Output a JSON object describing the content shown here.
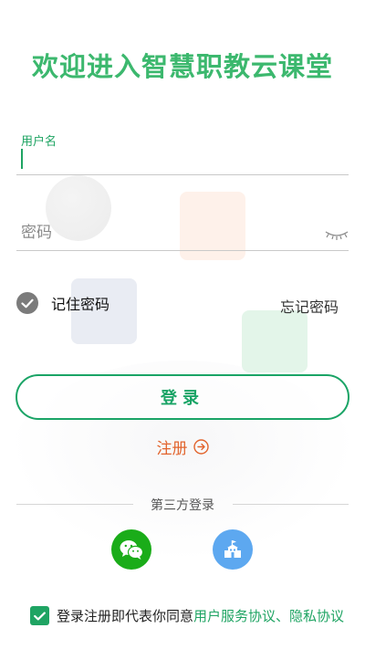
{
  "app_title": "欢迎进入智慧职教云课堂",
  "username": {
    "label": "用户名",
    "value": ""
  },
  "password": {
    "placeholder": "密码",
    "value": ""
  },
  "remember": {
    "label": "记住密码",
    "checked": true
  },
  "forgot_label": "忘记密码",
  "login_label": "登录",
  "register_label": "注册",
  "third_party_label": "第三方登录",
  "social": [
    {
      "name": "wechat",
      "icon": "wechat-icon",
      "color": "#1aac19"
    },
    {
      "name": "campus",
      "icon": "campus-building-icon",
      "color": "#5da8f0"
    }
  ],
  "agreement": {
    "prefix": "登录注册即代表你同意",
    "service_link": "用户服务协议",
    "separator": "、",
    "privacy_link": "隐私协议",
    "checked": true
  },
  "colors": {
    "accent": "#1fa463",
    "register": "#e2642d",
    "title": "#3cb86e"
  }
}
